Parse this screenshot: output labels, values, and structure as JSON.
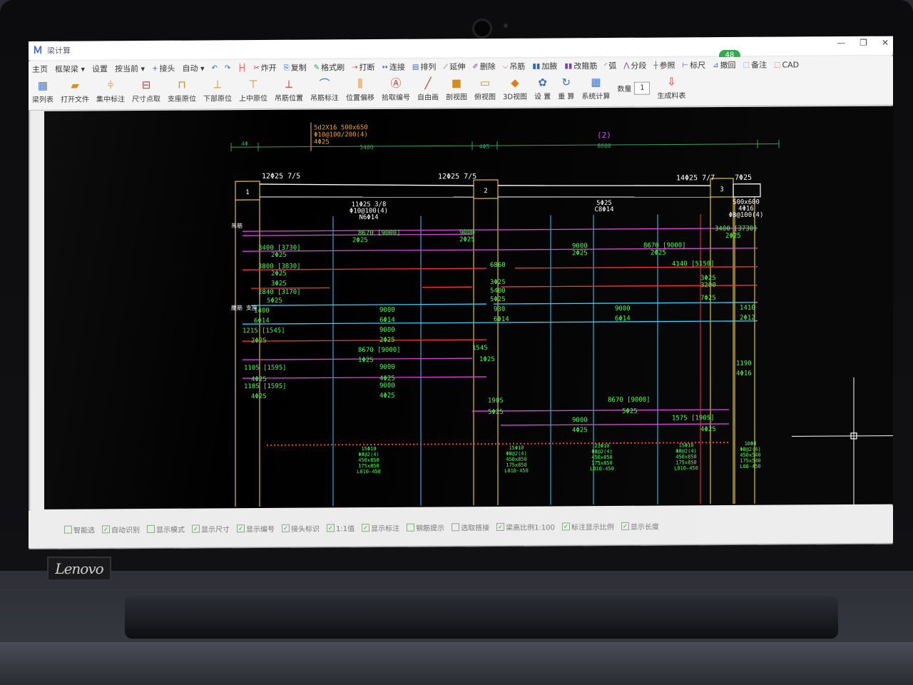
{
  "window": {
    "title": "梁计算",
    "update_badge": "48",
    "controls": [
      "—",
      "❐",
      "✕"
    ]
  },
  "menu": [
    {
      "icon": "",
      "label": "主页"
    },
    {
      "icon": "",
      "label": "框架梁 ▾"
    },
    {
      "icon": "",
      "label": "设置"
    },
    {
      "icon": "",
      "label": "按当前 ▾"
    },
    {
      "icon": "+",
      "label": "接头"
    },
    {
      "icon": "",
      "label": "自动 ▾"
    },
    {
      "icon": "↶",
      "label": ""
    },
    {
      "icon": "↷",
      "label": ""
    },
    {
      "icon": "├┤",
      "label": ""
    },
    {
      "icon": "✂",
      "label": "炸开"
    },
    {
      "icon": "⎘",
      "label": "复制"
    },
    {
      "icon": "✎",
      "label": "格式刷"
    },
    {
      "icon": "⇢",
      "label": "打断"
    },
    {
      "icon": "↔",
      "label": "连接"
    },
    {
      "icon": "▤",
      "label": "排列"
    },
    {
      "icon": "⟋",
      "label": "延伸"
    },
    {
      "icon": "✐",
      "label": "删除"
    },
    {
      "icon": "⌵",
      "label": "吊筋"
    },
    {
      "icon": "▮▮",
      "label": "加腋"
    },
    {
      "icon": "▮▮",
      "label": "改箍筋"
    },
    {
      "icon": "◜",
      "label": "弧"
    },
    {
      "icon": "⋀",
      "label": "分段"
    },
    {
      "icon": "┼",
      "label": "参照"
    },
    {
      "icon": "⊢",
      "label": "标尺"
    },
    {
      "icon": "⊿",
      "label": "撤回"
    },
    {
      "icon": "⬚",
      "label": "备注"
    },
    {
      "icon": "⬚",
      "label": "CAD"
    }
  ],
  "toolbar": [
    {
      "icon": "▦",
      "color": "c1",
      "label": "梁列表"
    },
    {
      "icon": "▰",
      "color": "c2",
      "label": "打开文件"
    },
    {
      "icon": "⫩",
      "color": "c2",
      "label": "集中标注"
    },
    {
      "icon": "⊟",
      "color": "c3",
      "label": "尺寸点取"
    },
    {
      "icon": "⊓",
      "color": "c2",
      "label": "支座原位"
    },
    {
      "icon": "⊥",
      "color": "c2",
      "label": "下部原位"
    },
    {
      "icon": "⊤",
      "color": "c2",
      "label": "上中原位"
    },
    {
      "icon": "⟂",
      "color": "c3",
      "label": "吊筋位置"
    },
    {
      "icon": "⌒",
      "color": "c1",
      "label": "吊筋标注"
    },
    {
      "icon": "⫼",
      "color": "c6",
      "label": "位置偏移"
    },
    {
      "icon": "Ⓐ",
      "color": "c3",
      "label": "拾取编号"
    },
    {
      "icon": "╱",
      "color": "c3",
      "label": "自由画"
    },
    {
      "icon": "■",
      "color": "c2",
      "label": "剖视图"
    },
    {
      "icon": "▭",
      "color": "c2",
      "label": "俯视图"
    },
    {
      "icon": "◆",
      "color": "c6",
      "label": "3D视图"
    },
    {
      "icon": "✿",
      "color": "c1",
      "label": "设 置"
    },
    {
      "icon": "↻",
      "color": "c1",
      "label": "重 算"
    },
    {
      "icon": "▦",
      "color": "c1",
      "label": "系统计算"
    },
    {
      "icon": "",
      "color": "",
      "label": "数量"
    },
    {
      "icon": "⇩",
      "color": "c3",
      "label": "生成料表"
    }
  ],
  "count_value": "1",
  "status": [
    {
      "checked": false,
      "label": "智能选"
    },
    {
      "checked": true,
      "label": "自动识别"
    },
    {
      "checked": false,
      "label": "显示模式"
    },
    {
      "checked": true,
      "label": "显示尺寸"
    },
    {
      "checked": true,
      "label": "显示编号"
    },
    {
      "checked": true,
      "label": "接头标识"
    },
    {
      "checked": true,
      "label": "1:1值"
    },
    {
      "checked": true,
      "label": "显示标注"
    },
    {
      "checked": false,
      "label": "钢筋提示"
    },
    {
      "checked": false,
      "label": "选取搭接"
    },
    {
      "checked": true,
      "label": "梁高比例1:100"
    },
    {
      "checked": true,
      "label": "标注显示比例"
    },
    {
      "checked": true,
      "label": "显示长度"
    }
  ],
  "drawing": {
    "header_label": [
      "5d2X16 500x650",
      "Φ10@100/200(4)",
      "4Φ25"
    ],
    "span_dims": [
      "4Φ",
      "5400",
      "4Φ5",
      "8600"
    ],
    "span_marker": "(2)",
    "support_marks": [
      "1",
      "2",
      "3"
    ],
    "top_labels": [
      "12Φ25 7/5",
      "12Φ25 7/5",
      "14Φ25 7/7",
      "7Φ25"
    ],
    "mid_labels": [
      [
        "11Φ25 3/8",
        "Φ10@100(4)",
        "N6Φ14"
      ],
      [
        "5Φ25",
        "C8Φ14"
      ],
      [
        "500x600",
        "4Φ16",
        "Φ8@100(4)"
      ]
    ],
    "rebar_labels": [
      "8670 [9000]",
      "2Φ25",
      "9000",
      "2Φ25",
      "3400 [3730]",
      "2Φ25",
      "3400 [3730]",
      "2Φ25",
      "9000",
      "2Φ25",
      "8670 [9000]",
      "2Φ25",
      "3800 [3830]",
      "2Φ25",
      "6860",
      "4140 [5150]",
      "3Φ25",
      "3Φ25",
      "3Φ25",
      "3200",
      "2840 [3170]",
      "5400",
      "5Φ25",
      "5Φ25",
      "7Φ25",
      "1400",
      "9000",
      "930",
      "9000",
      "1410",
      "6Φ14",
      "6Φ14",
      "6Φ14",
      "6Φ14",
      "2Φ12",
      "1215 [1545]",
      "9000",
      "2Φ25",
      "2Φ25",
      "1545",
      "8670 [9000]",
      "1Φ25",
      "1Φ25",
      "1105 [1595]",
      "9000",
      "1190",
      "4Φ16",
      "4Φ25",
      "4Φ25",
      "1185 [1595]",
      "9000",
      "4Φ25",
      "4Φ25",
      "1905",
      "8670 [9000]",
      "5Φ25",
      "5Φ25",
      "9000",
      "1575 [1905]",
      "4Φ25",
      "4Φ25"
    ],
    "stirrup_labels": [
      [
        "15Φ10",
        "Φ8@2(4)",
        "450x850",
        "175x850",
        "L010-450"
      ],
      [
        "15Φ10",
        "Φ8@2(4)",
        "450x850",
        "175x850",
        "L010-450"
      ],
      [
        "23Φ10",
        "Φ8@2(4)",
        "450x850",
        "175x850",
        "L010-450"
      ],
      [
        "15Φ10",
        "Φ8@2(4)",
        "450x850",
        "175x850",
        "L010-450"
      ],
      [
        "10Φ8",
        "Φ8@2(4)",
        "450x540",
        "175x540",
        "L08-450"
      ]
    ],
    "side_labels": [
      "吊筋",
      "腰筋 支座"
    ]
  },
  "laptop": {
    "brand": "Lenovo"
  },
  "colors": {
    "canvas": "#000000",
    "support_line": "#e0c030",
    "label_green": "#40ff40",
    "magenta": "#e040e0",
    "red": "#ff3030",
    "cyan": "#30d0ff",
    "white": "#ffffff"
  }
}
